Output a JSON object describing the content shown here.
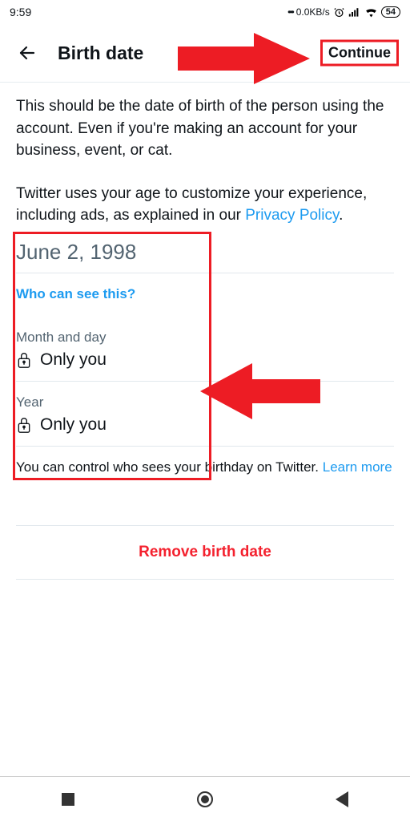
{
  "status": {
    "time": "9:59",
    "net_speed": "0.0KB/s",
    "battery": "54"
  },
  "header": {
    "title": "Birth date",
    "continue": "Continue"
  },
  "body": {
    "desc1": "This should be the date of birth of the person using the account. Even if you're making an account for your business, event, or cat.",
    "desc2_a": "Twitter uses your age to customize your experience, including ads, as explained in our ",
    "desc2_link": "Privacy Policy",
    "desc2_b": ".",
    "date": "June 2, 1998",
    "who": "Who can see this?",
    "month_label": "Month and day",
    "month_value": "Only you",
    "year_label": "Year",
    "year_value": "Only you",
    "footer_a": "You can control who sees your birthday on Twitter. ",
    "footer_link": "Learn more",
    "remove": "Remove birth date"
  }
}
